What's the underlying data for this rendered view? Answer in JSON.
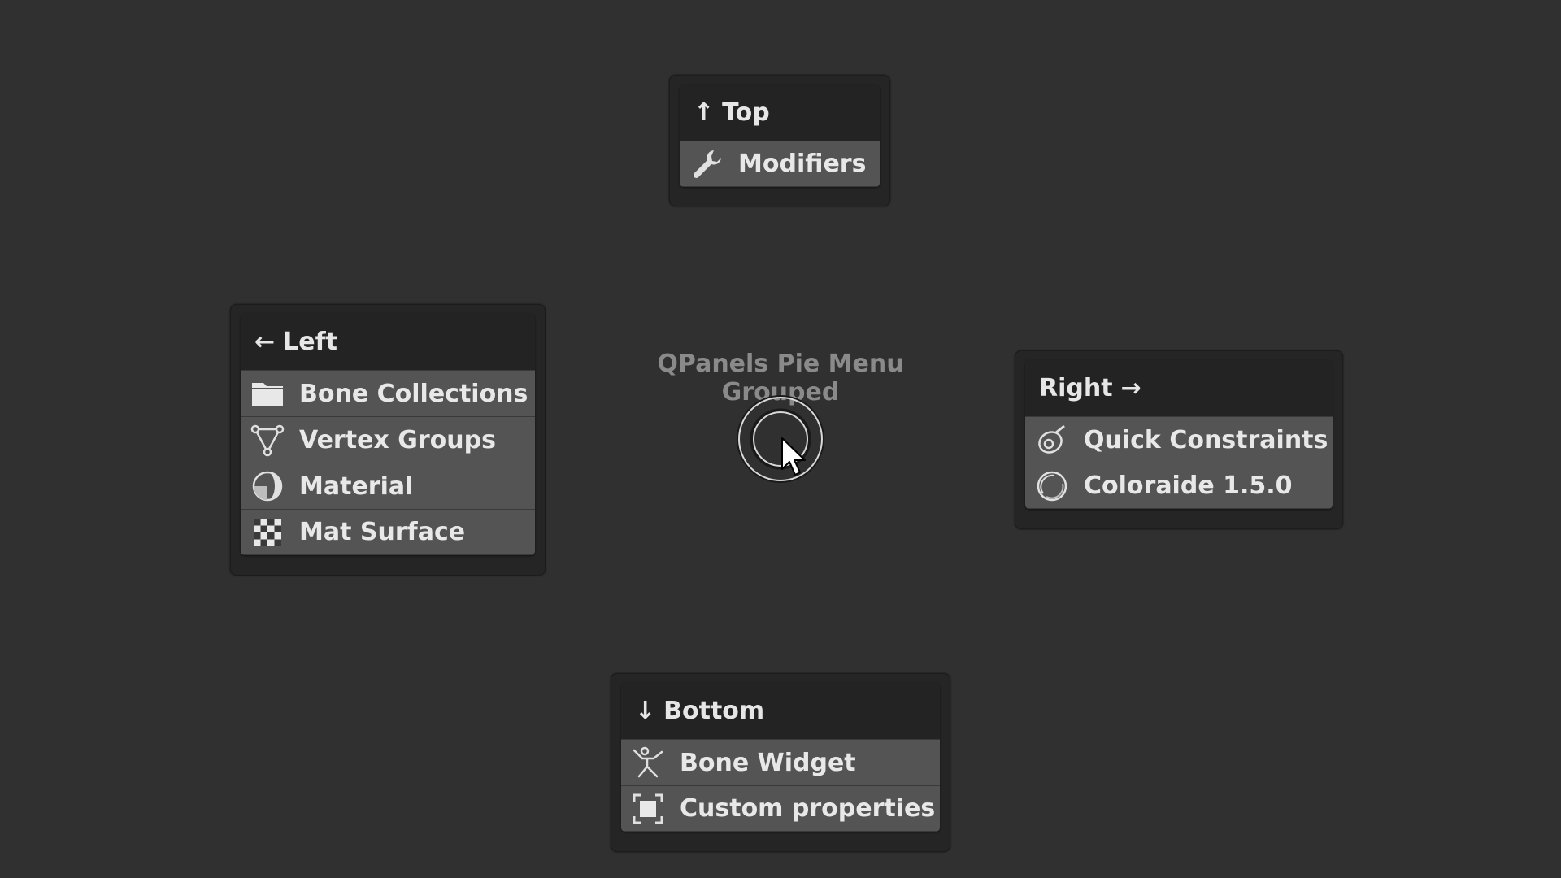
{
  "center": {
    "title": "QPanels Pie Menu Grouped"
  },
  "top": {
    "header": "Top",
    "arrow": "↑",
    "items": [
      {
        "label": "Modifiers",
        "icon": "wrench-icon"
      }
    ]
  },
  "left": {
    "header": "Left",
    "arrow": "←",
    "items": [
      {
        "label": "Bone Collections",
        "icon": "folder-icon"
      },
      {
        "label": "Vertex Groups",
        "icon": "vertex-groups-icon"
      },
      {
        "label": "Material",
        "icon": "material-sphere-icon"
      },
      {
        "label": "Mat Surface",
        "icon": "checker-icon"
      }
    ]
  },
  "right": {
    "header": "Right",
    "arrow": "→",
    "items": [
      {
        "label": "Quick Constraints",
        "icon": "constraint-icon"
      },
      {
        "label": "Coloraide 1.5.0",
        "icon": "color-sphere-icon"
      }
    ]
  },
  "bottom": {
    "header": "Bottom",
    "arrow": "↓",
    "items": [
      {
        "label": "Bone Widget",
        "icon": "pose-figure-icon"
      },
      {
        "label": "Custom properties",
        "icon": "custom-properties-icon"
      }
    ]
  },
  "colors": {
    "background": "#303030",
    "panel": "#252525",
    "header": "#232323",
    "item": "#545454",
    "text": "#e8e8e8",
    "title_text": "#8a8a8a"
  }
}
